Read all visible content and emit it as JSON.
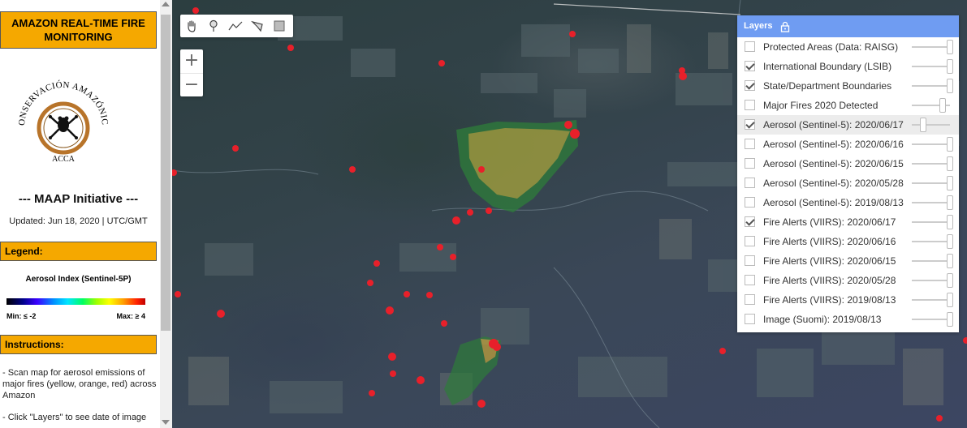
{
  "panel": {
    "title": "AMAZON REAL-TIME FIRE MONITORING",
    "logo": {
      "name": "CONSERVACIÓN AMAZÓNICA",
      "abbr": "ACCA"
    },
    "initiative": "--- MAAP Initiative ---",
    "updated": "Updated: Jun 18, 2020 | UTC/GMT",
    "legend_header": "Legend:",
    "legend": {
      "title": "Aerosol Index (Sentinel-5P)",
      "min": "Min: ≤ -2",
      "max": "Max: ≥ 4"
    },
    "instructions_header": "Instructions:",
    "instructions": [
      "- Scan map for aerosol emissions of major fires (yellow, orange, red) across Amazon",
      "- Click \"Layers\" to see date of image"
    ]
  },
  "toolbar": {
    "tools": [
      "hand-icon",
      "marker-icon",
      "line-icon",
      "polygon-icon",
      "rectangle-icon"
    ],
    "zoom_in": "+",
    "zoom_out": "−"
  },
  "layers_panel": {
    "title": "Layers",
    "items": [
      {
        "label": "Protected Areas (Data: RAISG)",
        "checked": false,
        "opacity": 1.0
      },
      {
        "label": "International Boundary (LSIB)",
        "checked": true,
        "opacity": 1.0
      },
      {
        "label": "State/Department Boundaries",
        "checked": true,
        "opacity": 1.0
      },
      {
        "label": "Major Fires 2020 Detected",
        "checked": false,
        "opacity": 0.8
      },
      {
        "label": "Aerosol (Sentinel-5): 2020/06/17",
        "checked": true,
        "opacity": 0.3,
        "highlighted": true
      },
      {
        "label": "Aerosol (Sentinel-5): 2020/06/16",
        "checked": false,
        "opacity": 1.0
      },
      {
        "label": "Aerosol (Sentinel-5): 2020/06/15",
        "checked": false,
        "opacity": 1.0
      },
      {
        "label": "Aerosol (Sentinel-5): 2020/05/28",
        "checked": false,
        "opacity": 1.0
      },
      {
        "label": "Aerosol (Sentinel-5): 2019/08/13",
        "checked": false,
        "opacity": 1.0
      },
      {
        "label": "Fire Alerts (VIIRS): 2020/06/17",
        "checked": true,
        "opacity": 1.0
      },
      {
        "label": "Fire Alerts (VIIRS): 2020/06/16",
        "checked": false,
        "opacity": 1.0
      },
      {
        "label": "Fire Alerts (VIIRS): 2020/06/15",
        "checked": false,
        "opacity": 1.0
      },
      {
        "label": "Fire Alerts (VIIRS): 2020/05/28",
        "checked": false,
        "opacity": 1.0
      },
      {
        "label": "Fire Alerts (VIIRS): 2019/08/13",
        "checked": false,
        "opacity": 1.0
      },
      {
        "label": "Image (Suomi): 2019/08/13",
        "checked": false,
        "opacity": 1.0
      }
    ]
  },
  "colors": {
    "title_bg": "#f5a800",
    "layers_header": "#6f9cf2",
    "fire_dot": "#e8202a",
    "aerosol_yellow": "#a9a53a",
    "aerosol_green": "#3e8f3e"
  }
}
